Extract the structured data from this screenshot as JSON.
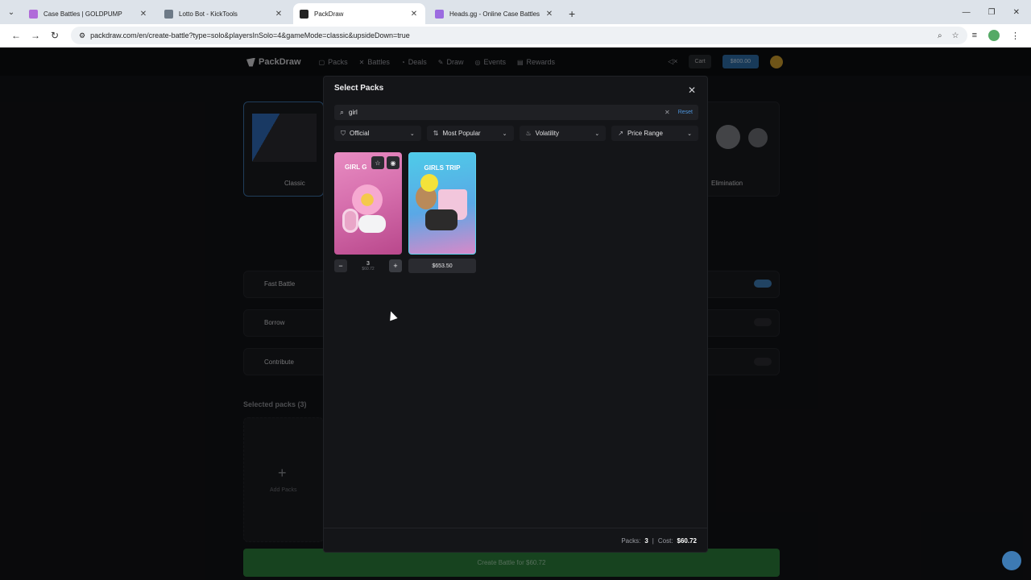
{
  "browser": {
    "tabs": [
      {
        "title": "Case Battles | GOLDPUMP",
        "color": "#b06bd9"
      },
      {
        "title": "Lotto Bot - KickTools",
        "color": "#6d7a87"
      },
      {
        "title": "PackDraw",
        "color": "#222222"
      },
      {
        "title": "Heads.gg - Online Case Battles",
        "color": "#9b6be0"
      }
    ],
    "url": "packdraw.com/en/create-battle?type=solo&playersInSolo=4&gameMode=classic&upsideDown=true"
  },
  "site": {
    "logo": "PackDraw",
    "nav": [
      {
        "label": "Packs",
        "icon": "packs-icon"
      },
      {
        "label": "Battles",
        "icon": "battles-icon"
      },
      {
        "label": "Deals",
        "icon": "deals-icon"
      },
      {
        "label": "Draw",
        "icon": "draw-icon"
      },
      {
        "label": "Events",
        "icon": "events-icon"
      },
      {
        "label": "Rewards",
        "icon": "rewards-icon"
      }
    ],
    "cart_label": "Cart",
    "balance": "$800.00",
    "modes": {
      "classic": "Classic",
      "elimination": "Elimination"
    },
    "options": {
      "fast_battle": "Fast Battle",
      "borrow": "Borrow",
      "contribute": "Contribute"
    },
    "selected_packs": "Selected packs (3)",
    "add_packs": "Add Packs",
    "create_label": "Create Battle for $60.72"
  },
  "modal": {
    "title": "Select Packs",
    "search_value": "girl",
    "reset_label": "Reset",
    "filters": [
      {
        "label": "Official",
        "icon": "official-icon"
      },
      {
        "label": "Most Popular",
        "icon": "sort-icon"
      },
      {
        "label": "Volatility",
        "icon": "flame-icon"
      },
      {
        "label": "Price Range",
        "icon": "trend-icon"
      }
    ],
    "packs": [
      {
        "title": "GIRL G",
        "quantity": "3",
        "sub_price": "$60.72"
      },
      {
        "title": "GIRLS TRIP",
        "price": "$653.50"
      }
    ],
    "footer": {
      "packs_label": "Packs:",
      "packs_count": "3",
      "cost_label": "Cost:",
      "cost_value": "$60.72"
    }
  }
}
